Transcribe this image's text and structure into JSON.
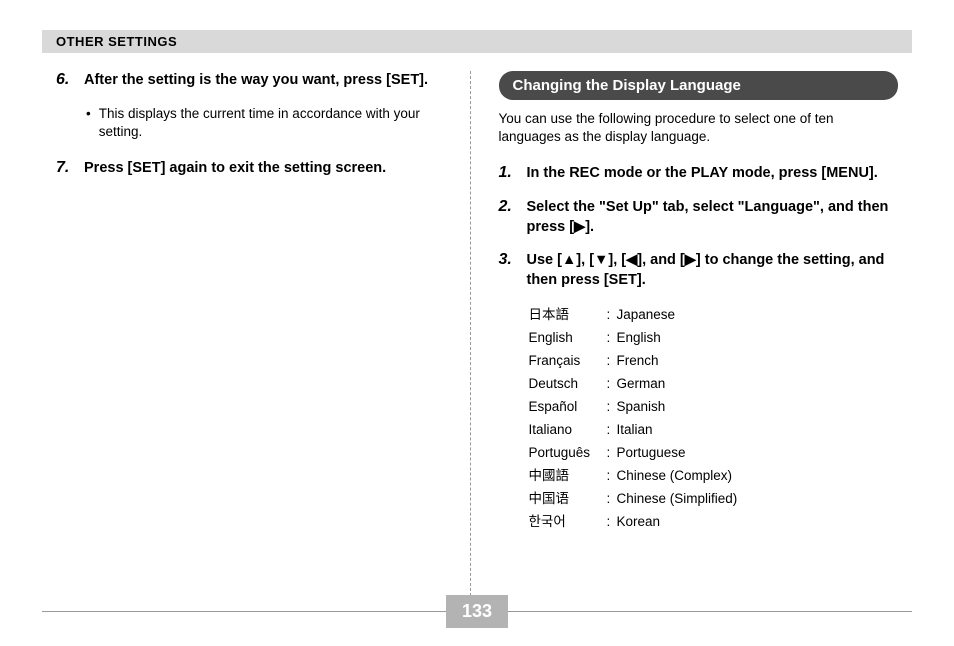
{
  "header": "OTHER SETTINGS",
  "left": {
    "step6_num": "6.",
    "step6_text": "After the setting is the way you want, press [SET].",
    "step6_bullet_dot": "•",
    "step6_bullet": "This displays the current time in accordance with your setting.",
    "step7_num": "7.",
    "step7_text": "Press [SET] again to exit the setting screen."
  },
  "right": {
    "section_title": "Changing the Display Language",
    "intro": "You can use the following procedure to select one of ten languages as the display language.",
    "step1_num": "1.",
    "step1_text": "In the REC mode or the PLAY mode, press [MENU].",
    "step2_num": "2.",
    "step2_text": "Select the \"Set Up\" tab, select \"Language\", and then press [▶].",
    "step3_num": "3.",
    "step3_text": "Use [▲], [▼], [◀], and [▶] to change the setting, and then press [SET].",
    "languages": [
      {
        "native": "日本語",
        "english": "Japanese"
      },
      {
        "native": "English",
        "english": "English"
      },
      {
        "native": "Français",
        "english": "French"
      },
      {
        "native": "Deutsch",
        "english": "German"
      },
      {
        "native": "Español",
        "english": "Spanish"
      },
      {
        "native": "Italiano",
        "english": "Italian"
      },
      {
        "native": "Português",
        "english": "Portuguese"
      },
      {
        "native": "中國語",
        "english": "Chinese (Complex)"
      },
      {
        "native": "中国语",
        "english": "Chinese (Simplified)"
      },
      {
        "native": "한국어",
        "english": "Korean"
      }
    ]
  },
  "page_number": "133"
}
